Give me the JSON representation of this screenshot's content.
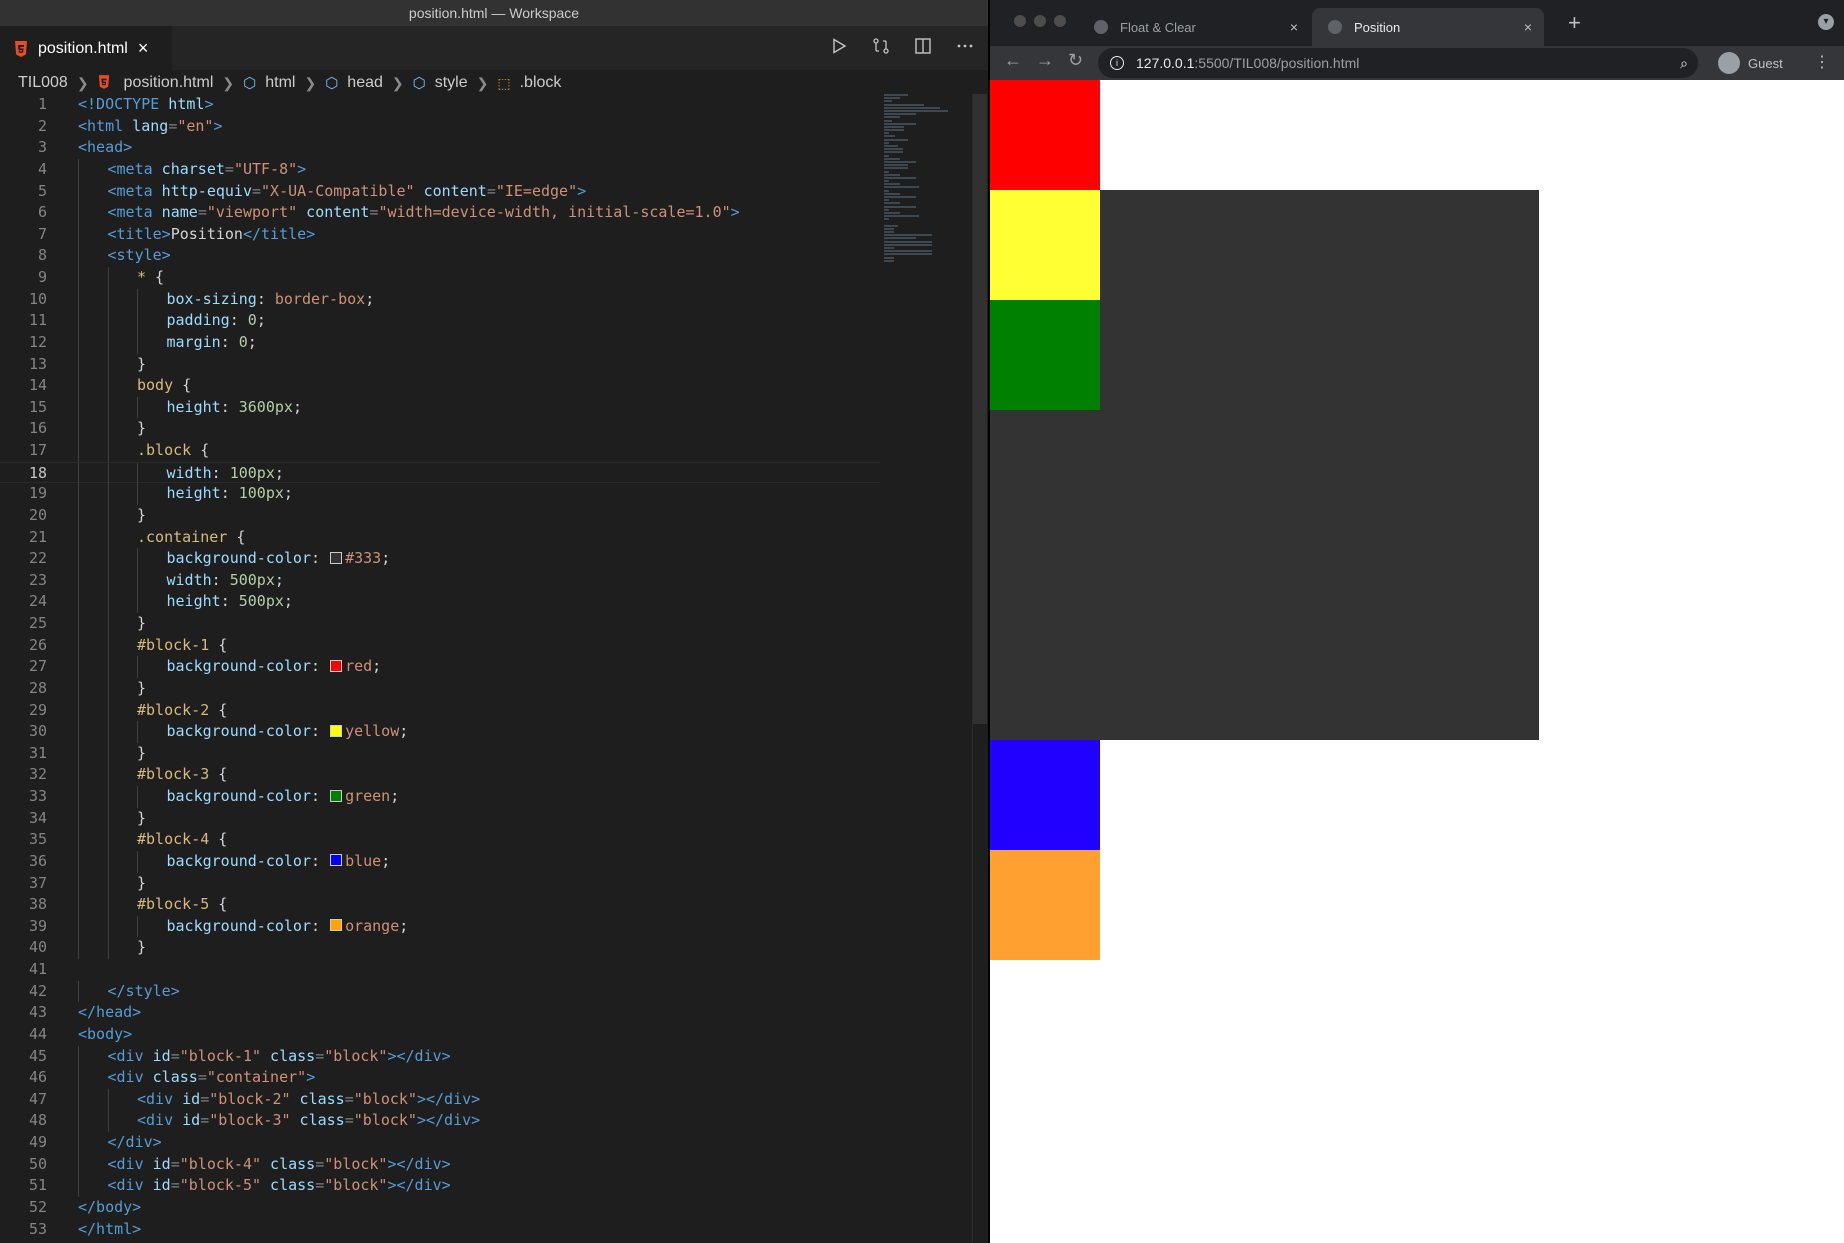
{
  "editor": {
    "window_title": "position.html — Workspace",
    "tab": {
      "label": "position.html",
      "close": "×"
    },
    "actions": [
      "run-icon",
      "compare-icon",
      "split-editor-icon",
      "more-icon"
    ],
    "breadcrumb": {
      "root": "TIL008",
      "file": "position.html",
      "items": [
        "html",
        "head",
        "style",
        ".block"
      ]
    },
    "lines": [
      {
        "n": "1"
      },
      {
        "n": "2"
      },
      {
        "n": "3"
      },
      {
        "n": "4"
      },
      {
        "n": "5"
      },
      {
        "n": "6"
      },
      {
        "n": "7"
      },
      {
        "n": "8"
      },
      {
        "n": "9"
      },
      {
        "n": "10"
      },
      {
        "n": "11"
      },
      {
        "n": "12"
      },
      {
        "n": "13"
      },
      {
        "n": "14"
      },
      {
        "n": "15"
      },
      {
        "n": "16"
      },
      {
        "n": "17"
      },
      {
        "n": "18"
      },
      {
        "n": "19"
      },
      {
        "n": "20"
      },
      {
        "n": "21"
      },
      {
        "n": "22"
      },
      {
        "n": "23"
      },
      {
        "n": "24"
      },
      {
        "n": "25"
      },
      {
        "n": "26"
      },
      {
        "n": "27"
      },
      {
        "n": "28"
      },
      {
        "n": "29"
      },
      {
        "n": "30"
      },
      {
        "n": "31"
      },
      {
        "n": "32"
      },
      {
        "n": "33"
      },
      {
        "n": "34"
      },
      {
        "n": "35"
      },
      {
        "n": "36"
      },
      {
        "n": "37"
      },
      {
        "n": "38"
      },
      {
        "n": "39"
      },
      {
        "n": "40"
      },
      {
        "n": "41"
      },
      {
        "n": "42"
      },
      {
        "n": "43"
      },
      {
        "n": "44"
      },
      {
        "n": "45"
      },
      {
        "n": "46"
      },
      {
        "n": "47"
      },
      {
        "n": "48"
      },
      {
        "n": "49"
      },
      {
        "n": "50"
      },
      {
        "n": "51"
      },
      {
        "n": "52"
      },
      {
        "n": "53"
      }
    ],
    "code": {
      "l1": {
        "a": "<!DOCTYPE",
        "b": " html",
        ">": ">"
      },
      "l2": {
        "open": "<html",
        "attr": " lang",
        "eq": "=",
        "val": "\"en\"",
        "close": ">"
      },
      "l3": {
        "open": "<head>"
      },
      "l4": {
        "open": "<meta",
        "attr": " charset",
        "eq": "=",
        "val": "\"UTF-8\"",
        "close": ">"
      },
      "l5": {
        "open": "<meta",
        "attr1": " http-equiv",
        "eq": "=",
        "val1": "\"X-UA-Compatible\"",
        "attr2": " content",
        "val2": "\"IE=edge\"",
        "close": ">"
      },
      "l6": {
        "open": "<meta",
        "attr1": " name",
        "eq": "=",
        "val1": "\"viewport\"",
        "attr2": " content",
        "val2": "\"width=device-width, initial-scale=1.0\"",
        "close": ">"
      },
      "l7": {
        "open": "<title>",
        "text": "Position",
        "close": "</title>"
      },
      "l8": {
        "open": "<style>"
      },
      "l9": {
        "sel": "*",
        "brace": " {"
      },
      "l10": {
        "prop": "box-sizing",
        "colon": ": ",
        "val": "border-box",
        "semi": ";"
      },
      "l11": {
        "prop": "padding",
        "colon": ": ",
        "val": "0",
        "semi": ";"
      },
      "l12": {
        "prop": "margin",
        "colon": ": ",
        "val": "0",
        "semi": ";"
      },
      "l13": {
        "brace": "}"
      },
      "l14": {
        "sel": "body",
        "brace": " {"
      },
      "l15": {
        "prop": "height",
        "colon": ": ",
        "val": "3600px",
        "semi": ";"
      },
      "l16": {
        "brace": "}"
      },
      "l17": {
        "sel": ".block",
        "brace": " {"
      },
      "l18": {
        "prop": "width",
        "colon": ": ",
        "val": "100px",
        "semi": ";"
      },
      "l19": {
        "prop": "height",
        "colon": ": ",
        "val": "100px",
        "semi": ";"
      },
      "l20": {
        "brace": "}"
      },
      "l21": {
        "sel": ".container",
        "brace": " {"
      },
      "l22": {
        "prop": "background-color",
        "colon": ": ",
        "val": "#333",
        "semi": ";"
      },
      "l23": {
        "prop": "width",
        "colon": ": ",
        "val": "500px",
        "semi": ";"
      },
      "l24": {
        "prop": "height",
        "colon": ": ",
        "val": "500px",
        "semi": ";"
      },
      "l25": {
        "brace": "}"
      },
      "l26": {
        "sel": "#block-1",
        "brace": " {"
      },
      "l27": {
        "prop": "background-color",
        "colon": ": ",
        "val": "red",
        "semi": ";"
      },
      "l28": {
        "brace": "}"
      },
      "l29": {
        "sel": "#block-2",
        "brace": " {"
      },
      "l30": {
        "prop": "background-color",
        "colon": ": ",
        "val": "yellow",
        "semi": ";"
      },
      "l31": {
        "brace": "}"
      },
      "l32": {
        "sel": "#block-3",
        "brace": " {"
      },
      "l33": {
        "prop": "background-color",
        "colon": ": ",
        "val": "green",
        "semi": ";"
      },
      "l34": {
        "brace": "}"
      },
      "l35": {
        "sel": "#block-4",
        "brace": " {"
      },
      "l36": {
        "prop": "background-color",
        "colon": ": ",
        "val": "blue",
        "semi": ";"
      },
      "l37": {
        "brace": "}"
      },
      "l38": {
        "sel": "#block-5",
        "brace": " {"
      },
      "l39": {
        "prop": "background-color",
        "colon": ": ",
        "val": "orange",
        "semi": ";"
      },
      "l40": {
        "brace": "}"
      },
      "l42": {
        "close": "</style>"
      },
      "l43": {
        "close": "</head>"
      },
      "l44": {
        "open": "<body>"
      },
      "l45": {
        "open": "<div",
        "attr1": " id",
        "eq": "=",
        "val1": "\"block-1\"",
        "attr2": " class",
        "val2": "\"block\"",
        "close": "></div>"
      },
      "l46": {
        "open": "<div",
        "attr": " class",
        "eq": "=",
        "val": "\"container\"",
        "close": ">"
      },
      "l47": {
        "open": "<div",
        "attr1": " id",
        "eq": "=",
        "val1": "\"block-2\"",
        "attr2": " class",
        "val2": "\"block\"",
        "close": "></div>"
      },
      "l48": {
        "open": "<div",
        "attr1": " id",
        "eq": "=",
        "val1": "\"block-3\"",
        "attr2": " class",
        "val2": "\"block\"",
        "close": "></div>"
      },
      "l49": {
        "close": "</div>"
      },
      "l50": {
        "open": "<div",
        "attr1": " id",
        "eq": "=",
        "val1": "\"block-4\"",
        "attr2": " class",
        "val2": "\"block\"",
        "close": "></div>"
      },
      "l51": {
        "open": "<div",
        "attr1": " id",
        "eq": "=",
        "val1": "\"block-5\"",
        "attr2": " class",
        "val2": "\"block\"",
        "close": "></div>"
      },
      "l52": {
        "close": "</body>"
      },
      "l53": {
        "close": "</html>"
      }
    },
    "swatch_colors": {
      "c333": "#333333",
      "red": "#ff0000",
      "yellow": "#ffff00",
      "green": "#008000",
      "blue": "#0000ff",
      "orange": "#ffa500"
    }
  },
  "browser": {
    "tabs": [
      {
        "label": "Float & Clear",
        "close": "×"
      },
      {
        "label": "Position",
        "close": "×"
      }
    ],
    "new_tab": "+",
    "url_host": "127.0.0.1",
    "url_rest": ":5500/TIL008/position.html",
    "profile": "Guest",
    "page": {
      "block_colors": {
        "block1": "#ff0000",
        "block2": "#ffff33",
        "block3": "#008000",
        "block4": "#2200ff",
        "block5": "#ffa031",
        "container": "#333333"
      }
    }
  }
}
